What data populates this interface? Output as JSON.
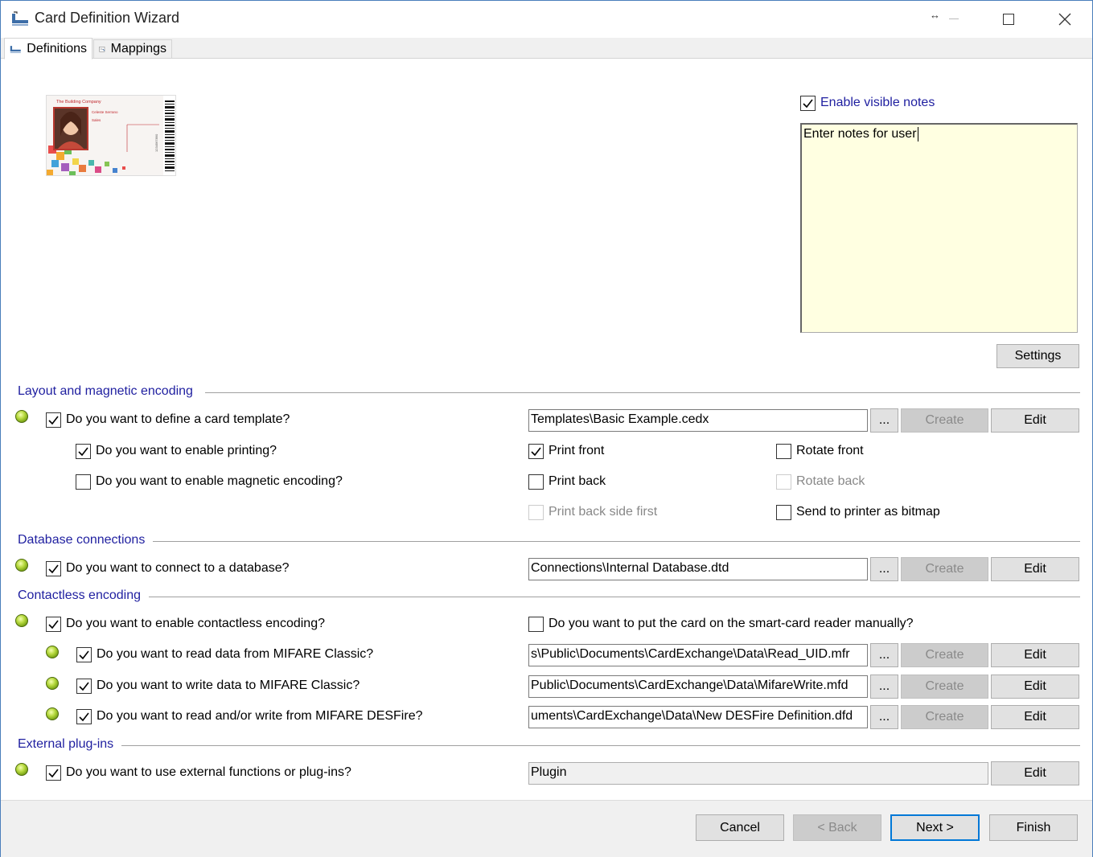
{
  "window": {
    "title": "Card Definition Wizard",
    "accent": "#4a7ebb"
  },
  "tabs": [
    {
      "label": "Definitions",
      "active": true
    },
    {
      "label": "Mappings",
      "active": false
    }
  ],
  "card_preview": {
    "company": "The Building Company",
    "name": "Celeste Serrano",
    "department": "Sales",
    "number": "1234567890"
  },
  "notes": {
    "enable_label": "Enable visible notes",
    "enabled": true,
    "text": "Enter notes for user",
    "settings_label": "Settings",
    "background": "#ffffe1"
  },
  "sections": {
    "layout": "Layout and magnetic encoding",
    "database": "Database connections",
    "contactless": "Contactless encoding",
    "plugins": "External plug-ins"
  },
  "layout": {
    "define_template": {
      "label": "Do you want to define a card template?",
      "checked": true,
      "path": "Templates\\Basic Example.cedx"
    },
    "enable_printing": {
      "label": "Do you want to enable printing?",
      "checked": true
    },
    "enable_magnetic": {
      "label": "Do you want to enable magnetic encoding?",
      "checked": false
    },
    "print_front": {
      "label": "Print front",
      "checked": true
    },
    "print_back": {
      "label": "Print back",
      "checked": false
    },
    "print_back_first": {
      "label": "Print back side first",
      "checked": false,
      "disabled": true
    },
    "rotate_front": {
      "label": "Rotate front",
      "checked": false
    },
    "rotate_back": {
      "label": "Rotate back",
      "checked": false,
      "disabled": true
    },
    "send_bitmap": {
      "label": "Send to printer as bitmap",
      "checked": false
    }
  },
  "database": {
    "connect": {
      "label": "Do you want to connect to a database?",
      "checked": true,
      "path": "Connections\\Internal Database.dtd"
    }
  },
  "contactless": {
    "enable": {
      "label": "Do you want to enable contactless encoding?",
      "checked": true
    },
    "manual": {
      "label": "Do you want to put the card on the smart-card reader manually?",
      "checked": false
    },
    "mifare_read": {
      "label": "Do you want to read data from MIFARE Classic?",
      "checked": true,
      "path": "s\\Public\\Documents\\CardExchange\\Data\\Read_UID.mfr"
    },
    "mifare_write": {
      "label": "Do you want to write data to MIFARE Classic?",
      "checked": true,
      "path": "Public\\Documents\\CardExchange\\Data\\MifareWrite.mfd"
    },
    "desfire": {
      "label": "Do you want to read and/or write from MIFARE DESFire?",
      "checked": true,
      "path": "uments\\CardExchange\\Data\\New DESFire Definition.dfd"
    }
  },
  "plugins": {
    "use": {
      "label": "Do you want to use external functions or plug-ins?",
      "checked": true,
      "value": "Plugin"
    }
  },
  "buttons": {
    "browse": "...",
    "create": "Create",
    "edit": "Edit",
    "cancel": "Cancel",
    "back": "< Back",
    "next": "Next >",
    "finish": "Finish"
  }
}
